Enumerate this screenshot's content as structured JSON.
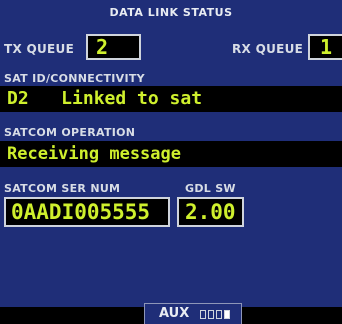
{
  "page_title": "DATA LINK STATUS",
  "tx_queue": {
    "label": "TX QUEUE",
    "value": "2"
  },
  "rx_queue": {
    "label": "RX QUEUE",
    "value": "1"
  },
  "sat_id": {
    "label": "SAT ID/CONNECTIVITY",
    "value": "D2   Linked to sat"
  },
  "satcom_operation": {
    "label": "SATCOM OPERATION",
    "value": "Receiving message"
  },
  "satcom_ser_num": {
    "label": "SATCOM SER NUM",
    "value": "0AADI005555"
  },
  "gdl_sw": {
    "label": "GDL SW",
    "value": "2.00"
  },
  "footer": {
    "page_group": "AUX",
    "page_count": 4,
    "active_page": 4
  },
  "colors": {
    "background": "#1f2e78",
    "field_background": "#000000",
    "field_text": "#cff02d",
    "label_text": "#d8dde6"
  }
}
